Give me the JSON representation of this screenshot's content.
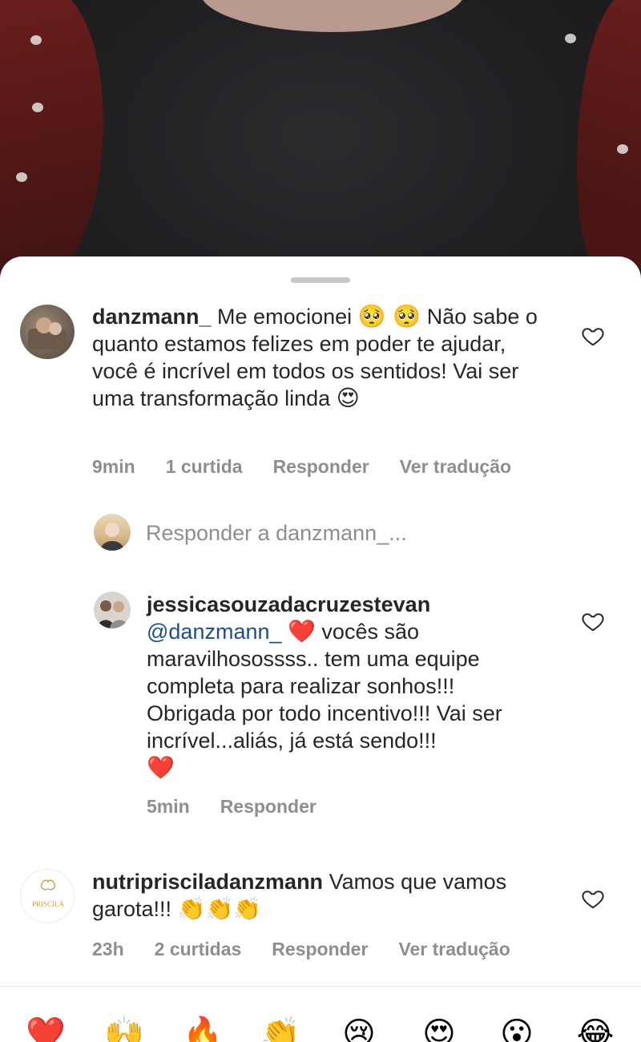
{
  "comments": [
    {
      "username": "danzmann_",
      "text_before": "Me emocionei",
      "emojis_1": "🥺 🥺",
      "text_after": "Não sabe o quanto estamos felizes em poder te ajudar, você é incrível em todos os sentidos! Vai ser uma transformação linda",
      "emoji_end": "😍",
      "time": "9min",
      "likes": "1 curtida",
      "reply_label": "Responder",
      "translate_label": "Ver tradução"
    },
    {
      "username": "jessicasouzadacruzestevan",
      "mention": "@danzmann_",
      "heart": "❤️",
      "text": "vocês são maravilhosossss.. tem uma equipe completa para realizar sonhos!!! Obrigada por todo incentivo!!! Vai ser incrível...aliás,  já está sendo!!!",
      "heart_end": "❤️",
      "time": "5min",
      "reply_label": "Responder"
    },
    {
      "username": "nutriprisciladanzmann",
      "text": "Vamos que vamos garota!!!",
      "emojis": "👏👏👏",
      "time": "23h",
      "likes": "2 curtidas",
      "reply_label": "Responder",
      "translate_label": "Ver tradução",
      "avatar_logo_text": "PRISCILA"
    }
  ],
  "reply_input": {
    "placeholder": "Responder a danzmann_..."
  },
  "reactions": [
    "❤️",
    "🙌",
    "🔥",
    "👏",
    "😢",
    "😍",
    "😮",
    "😂"
  ],
  "colors": {
    "mention": "#1c4f8a",
    "meta": "#8e8e8e",
    "text": "#262626"
  }
}
